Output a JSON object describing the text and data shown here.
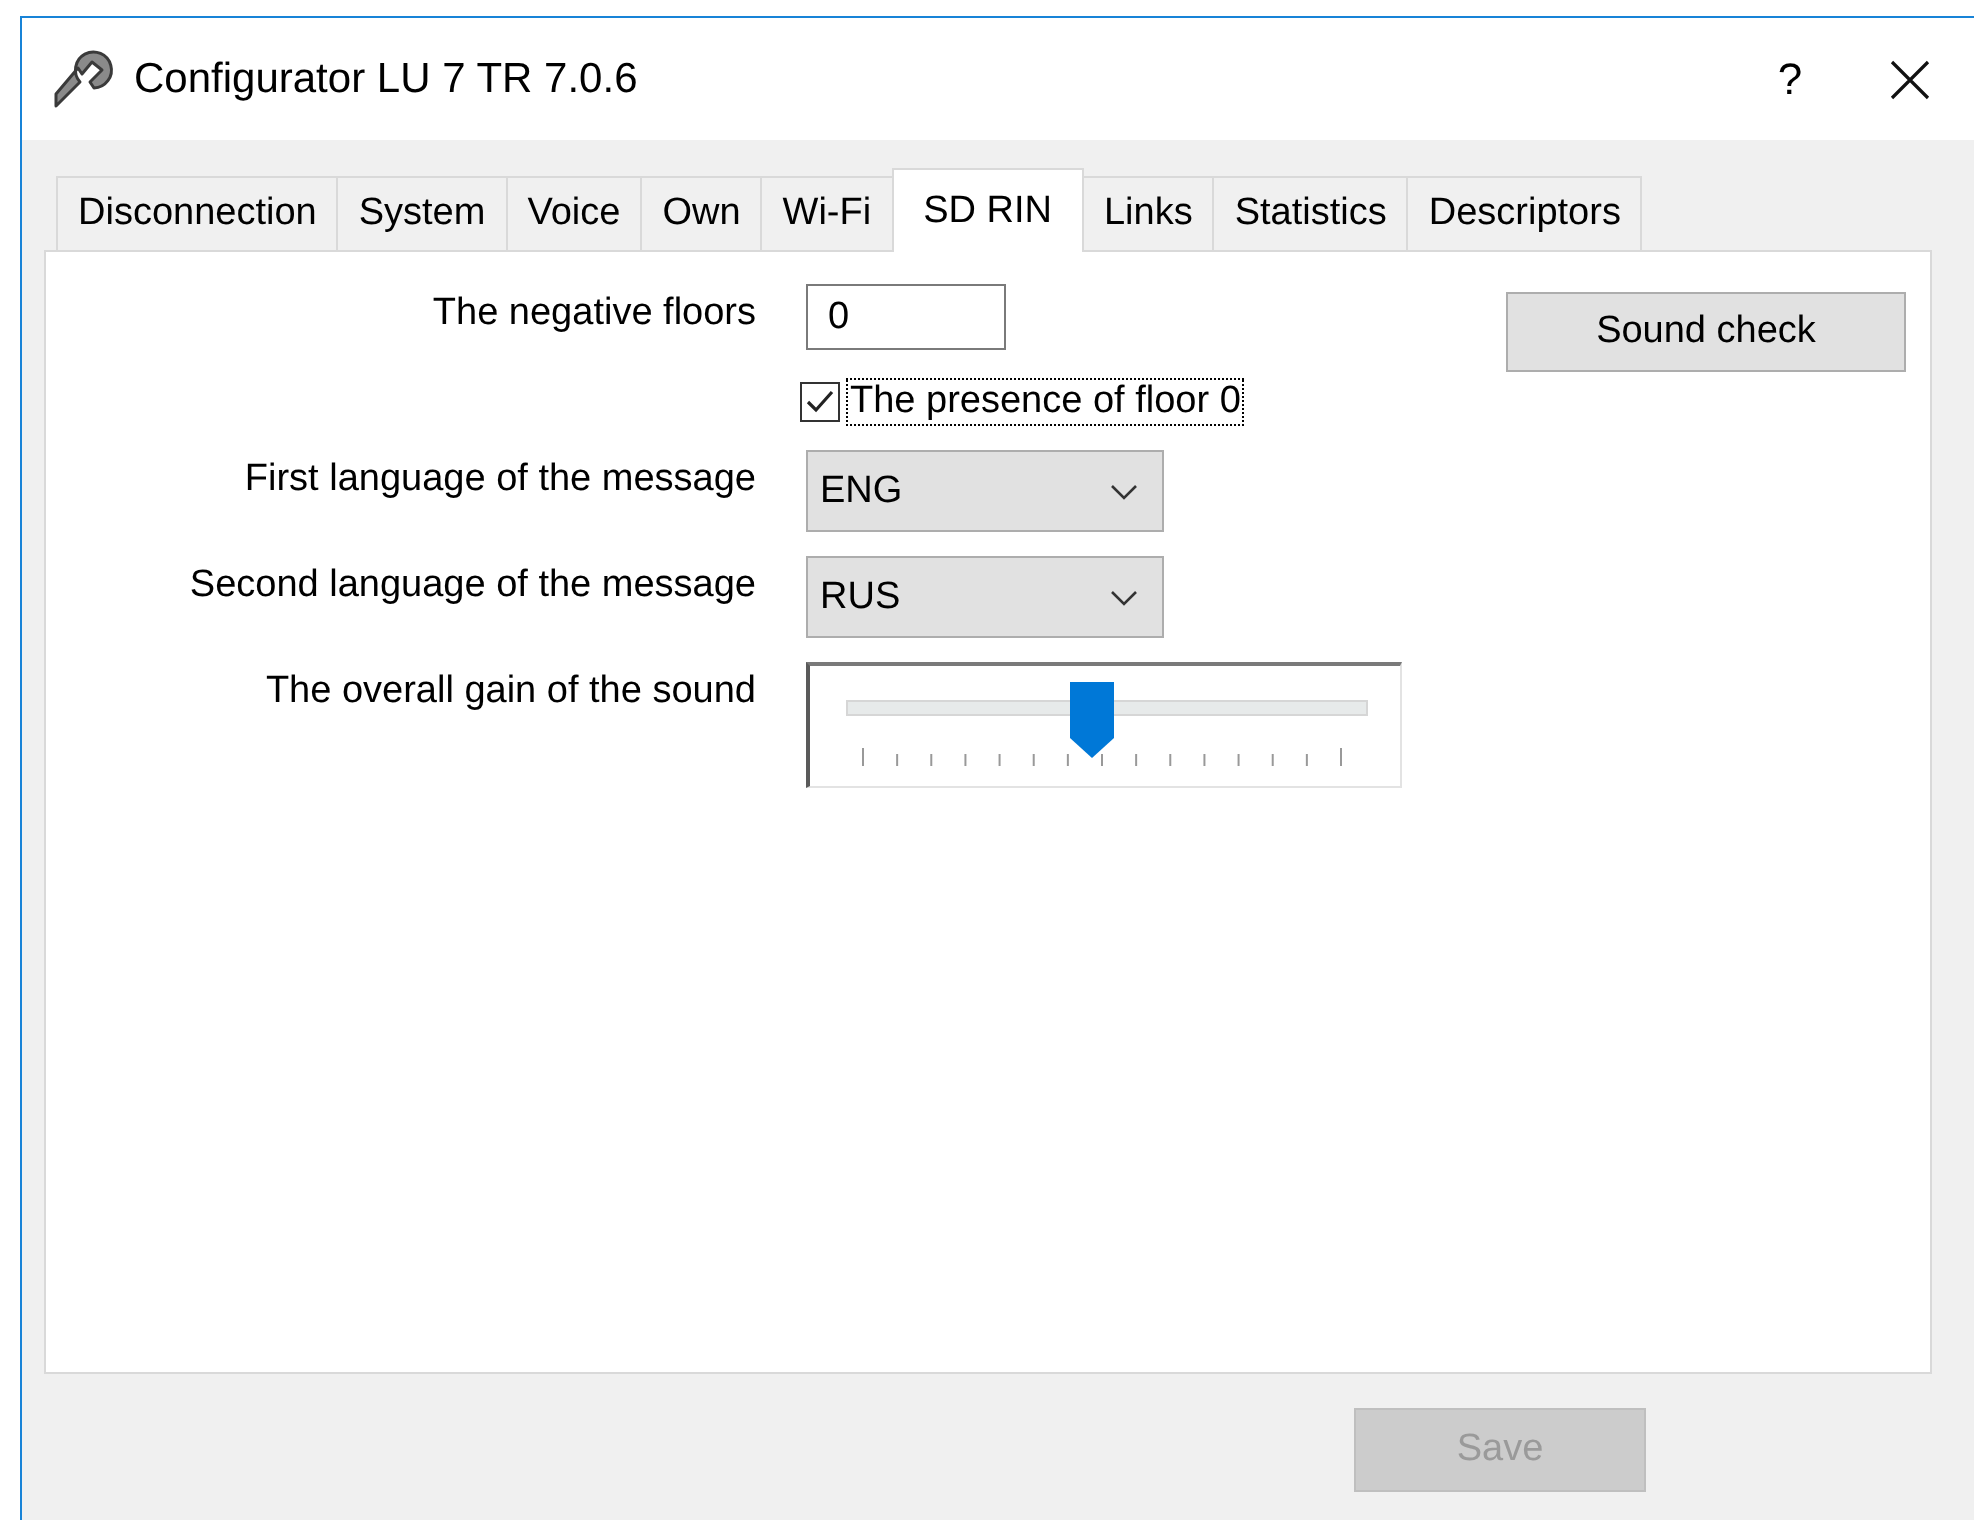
{
  "window": {
    "title": "Configurator LU 7 TR 7.0.6",
    "help": "?"
  },
  "tabs": [
    {
      "label": "Disconnection",
      "selected": false
    },
    {
      "label": "System",
      "selected": false
    },
    {
      "label": "Voice",
      "selected": false
    },
    {
      "label": "Own",
      "selected": false
    },
    {
      "label": "Wi-Fi",
      "selected": false
    },
    {
      "label": "SD RIN",
      "selected": true
    },
    {
      "label": "Links",
      "selected": false
    },
    {
      "label": "Statistics",
      "selected": false
    },
    {
      "label": "Descriptors",
      "selected": false
    }
  ],
  "fields": [
    {
      "kind": "text",
      "label": "The negative floors",
      "value": "0"
    },
    {
      "kind": "checkbox",
      "label": "The presence of floor 0",
      "checked": true,
      "focused": true
    },
    {
      "kind": "dropdown",
      "label": "First language of the message",
      "value": "ENG"
    },
    {
      "kind": "dropdown",
      "label": "Second language of the message",
      "value": "RUS"
    },
    {
      "kind": "slider",
      "label": "The overall gain of the sound",
      "level": 0.47
    }
  ],
  "sound_check_button": {
    "label": "Sound check",
    "disabled": false
  },
  "save_button": {
    "label": "Save",
    "disabled": true
  }
}
